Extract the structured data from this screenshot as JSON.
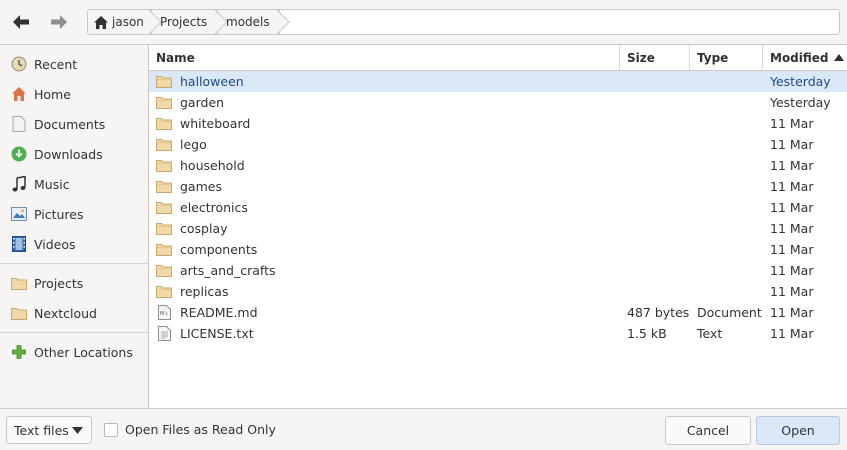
{
  "header": {
    "back_icon": "arrow-left-icon",
    "forward_icon": "arrow-right-icon",
    "breadcrumbs": [
      "jason",
      "Projects",
      "models"
    ]
  },
  "sidebar": {
    "items": [
      {
        "label": "Recent",
        "icon": "recent-clock-icon"
      },
      {
        "label": "Home",
        "icon": "home-icon"
      },
      {
        "label": "Documents",
        "icon": "document-icon"
      },
      {
        "label": "Downloads",
        "icon": "download-icon"
      },
      {
        "label": "Music",
        "icon": "music-note-icon"
      },
      {
        "label": "Pictures",
        "icon": "picture-icon"
      },
      {
        "label": "Videos",
        "icon": "film-icon"
      },
      {
        "label": "Projects",
        "icon": "folder-icon"
      },
      {
        "label": "Nextcloud",
        "icon": "folder-icon"
      },
      {
        "label": "Other Locations",
        "icon": "plus-icon"
      }
    ]
  },
  "columns": {
    "name": "Name",
    "size": "Size",
    "type": "Type",
    "modified": "Modified"
  },
  "files": [
    {
      "name": "halloween",
      "size": "",
      "type": "",
      "modified": "Yesterday",
      "kind": "folder",
      "selected": true
    },
    {
      "name": "garden",
      "size": "",
      "type": "",
      "modified": "Yesterday",
      "kind": "folder"
    },
    {
      "name": "whiteboard",
      "size": "",
      "type": "",
      "modified": "11 Mar",
      "kind": "folder"
    },
    {
      "name": "lego",
      "size": "",
      "type": "",
      "modified": "11 Mar",
      "kind": "folder"
    },
    {
      "name": "household",
      "size": "",
      "type": "",
      "modified": "11 Mar",
      "kind": "folder"
    },
    {
      "name": "games",
      "size": "",
      "type": "",
      "modified": "11 Mar",
      "kind": "folder"
    },
    {
      "name": "electronics",
      "size": "",
      "type": "",
      "modified": "11 Mar",
      "kind": "folder"
    },
    {
      "name": "cosplay",
      "size": "",
      "type": "",
      "modified": "11 Mar",
      "kind": "folder"
    },
    {
      "name": "components",
      "size": "",
      "type": "",
      "modified": "11 Mar",
      "kind": "folder"
    },
    {
      "name": "arts_and_crafts",
      "size": "",
      "type": "",
      "modified": "11 Mar",
      "kind": "folder"
    },
    {
      "name": "replicas",
      "size": "",
      "type": "",
      "modified": "11 Mar",
      "kind": "folder"
    },
    {
      "name": "README.md",
      "size": "487 bytes",
      "type": "Document",
      "modified": "11 Mar",
      "kind": "markdown"
    },
    {
      "name": "LICENSE.txt",
      "size": "1.5 kB",
      "type": "Text",
      "modified": "11 Mar",
      "kind": "text"
    }
  ],
  "bottom": {
    "filter_value": "Text files",
    "readonly_label": "Open Files as Read Only",
    "cancel_label": "Cancel",
    "open_label": "Open"
  },
  "colors": {
    "selection": "#dbe8f7",
    "folder": "#f0d9a8",
    "accent": "#3584e4"
  }
}
